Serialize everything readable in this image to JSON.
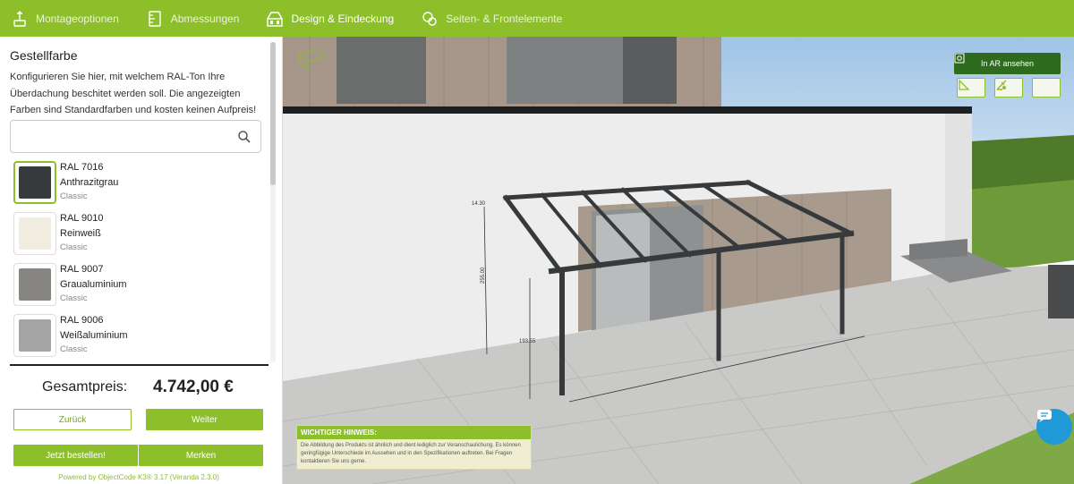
{
  "nav": {
    "steps": [
      {
        "label": "Montageoptionen",
        "icon": "mounting-icon"
      },
      {
        "label": "Abmessungen",
        "icon": "ruler-icon"
      },
      {
        "label": "Design & Eindeckung",
        "icon": "palette-icon"
      },
      {
        "label": "Seiten- & Frontelemente",
        "icon": "elements-icon"
      }
    ],
    "active_index": 2
  },
  "sidebar": {
    "title": "Gestellfarbe",
    "description": "Konfigurieren Sie hier, mit welchem RAL-Ton Ihre Überdachung beschitet werden soll. Die angezeigten Farben sind Standardfarben und kosten keinen Aufpreis!",
    "search": {
      "value": "",
      "placeholder": ""
    },
    "colors": [
      {
        "code": "RAL 7016",
        "name": "Anthrazitgrau",
        "category": "Classic",
        "hex": "#373a3d",
        "selected": true
      },
      {
        "code": "RAL 9010",
        "name": "Reinweiß",
        "category": "Classic",
        "hex": "#f1ede1",
        "selected": false
      },
      {
        "code": "RAL 9007",
        "name": "Graualuminium",
        "category": "Classic",
        "hex": "#878581",
        "selected": false
      },
      {
        "code": "RAL 9006",
        "name": "Weißaluminium",
        "category": "Classic",
        "hex": "#a5a5a5",
        "selected": false
      }
    ]
  },
  "summary": {
    "price_label": "Gesamtpreis:",
    "price_value": "4.742,00 €"
  },
  "buttons": {
    "back": "Zurück",
    "next": "Weiter",
    "order": "Jetzt bestellen!",
    "save": "Merken"
  },
  "footer": {
    "powered": "Powered by ObjectCode K3® 3.17 (Veranda 2.3.0)"
  },
  "scene": {
    "ar_button": "In AR ansehen",
    "view_icons": [
      "measure-icon",
      "sun-angle-icon",
      "moon-icon"
    ],
    "dimensions": {
      "height_front": "14.30",
      "height_side": "255.00",
      "depth": "193.55"
    },
    "notice": {
      "title": "WICHTIGER HINWEIS:",
      "text": "Die Abbildung des Produkts ist ähnlich und dient lediglich zur Veranschaulichung. Es können geringfügige Unterschiede im Aussehen und in den Spezifikationen auftreten. Bei Fragen kontaktieren Sie uns gerne."
    }
  },
  "colors": {
    "brand_green": "#8dbf2a",
    "dark_green": "#2f6b1e",
    "frame": "#373a3d",
    "chat_blue": "#1f9ad6"
  }
}
